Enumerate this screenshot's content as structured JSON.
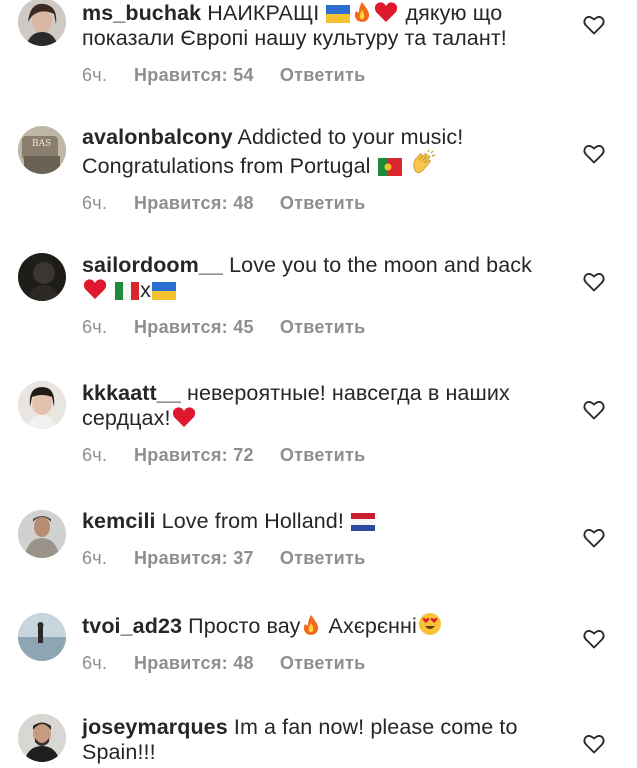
{
  "comments": [
    {
      "username": "ms_buchak",
      "text_1": " НАИКРАЩІ ",
      "text_2": " дякую що показали Європі нашу культуру та талант!",
      "age": "6ч.",
      "likes": "Нравится: 54",
      "reply": "Ответить"
    },
    {
      "username": "avalonbalcony",
      "text_1": " Addicted to your music! Congratulations from Portugal ",
      "text_2": "",
      "age": "6ч.",
      "likes": "Нравится: 48",
      "reply": "Ответить"
    },
    {
      "username": "sailordoom__",
      "text_1": " Love you to the moon and back",
      "text_2": "x",
      "age": "6ч.",
      "likes": "Нравится: 45",
      "reply": "Ответить"
    },
    {
      "username": "kkkaatt__",
      "text_1": " невероятные! навсегда в наших сердцах!",
      "text_2": "",
      "age": "6ч.",
      "likes": "Нравится: 72",
      "reply": "Ответить"
    },
    {
      "username": "kemcili",
      "text_1": " Love from Holland! ",
      "text_2": "",
      "age": "6ч.",
      "likes": "Нравится: 37",
      "reply": "Ответить"
    },
    {
      "username": "tvoi_ad23",
      "text_1": " Просто вау",
      "text_2": " Ахєрєнні",
      "age": "6ч.",
      "likes": "Нравится: 48",
      "reply": "Ответить"
    },
    {
      "username": "joseymarques",
      "text_1": " Im a fan now! please come to Spain!!!",
      "text_2": "",
      "age": "",
      "likes": "",
      "reply": ""
    }
  ],
  "icons": {
    "like": "heart-outline-icon",
    "flags": [
      "ukraine-flag-icon",
      "portugal-flag-icon",
      "italy-flag-icon",
      "netherlands-flag-icon"
    ],
    "emoji": [
      "fire-emoji-icon",
      "red-heart-emoji-icon",
      "clapping-hands-emoji-icon",
      "heart-eyes-emoji-icon"
    ]
  },
  "colors": {
    "text": "#262626",
    "meta": "#8e8e8e",
    "heart_red": "#e0182d"
  }
}
